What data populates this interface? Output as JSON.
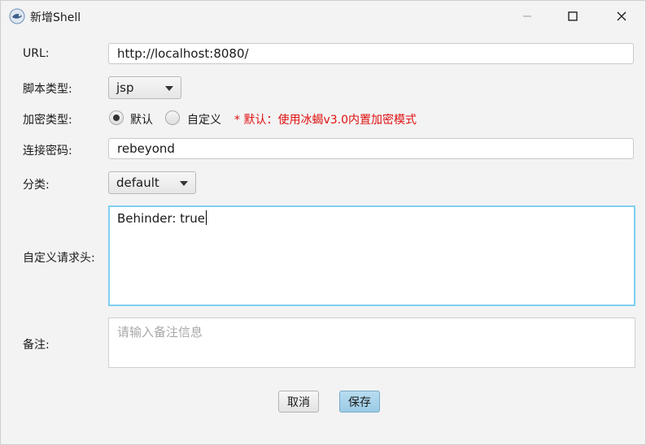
{
  "window": {
    "title": "新增Shell"
  },
  "form": {
    "url": {
      "label": "URL:",
      "value": "http://localhost:8080/"
    },
    "script_type": {
      "label": "脚本类型:",
      "value": "jsp"
    },
    "encrypt_type": {
      "label": "加密类型:",
      "options": [
        "默认",
        "自定义"
      ],
      "selected": "默认",
      "note": "* 默认：使用冰蝎v3.0内置加密模式"
    },
    "password": {
      "label": "连接密码:",
      "value": "rebeyond"
    },
    "category": {
      "label": "分类:",
      "value": "default"
    },
    "headers": {
      "label": "自定义请求头:",
      "value": "Behinder: true"
    },
    "remark": {
      "label": "备注:",
      "placeholder": "请输入备注信息"
    }
  },
  "buttons": {
    "cancel": "取消",
    "save": "保存"
  },
  "colors": {
    "note": "#e01010",
    "focus_border": "#7fd0f0",
    "save_button": "#9bcbe6"
  }
}
